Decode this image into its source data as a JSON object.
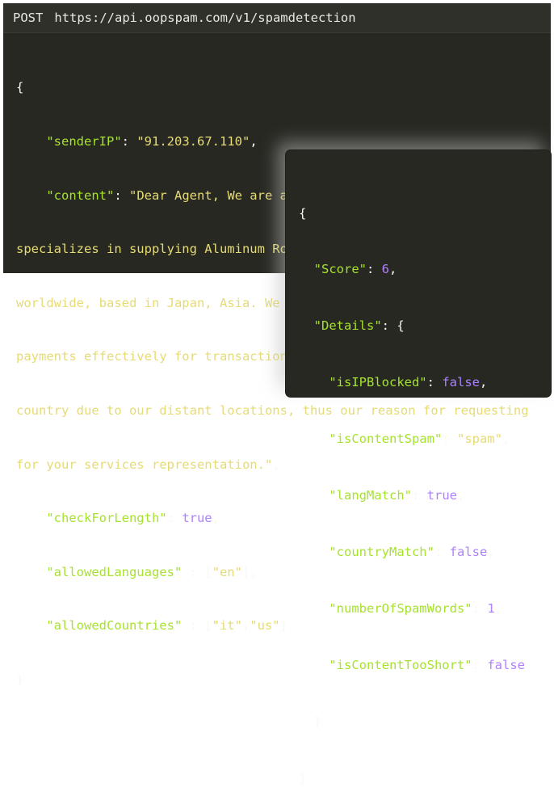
{
  "request": {
    "method": "POST",
    "url": "https://api.oopspam.com/v1/spamdetection",
    "open_brace": "{",
    "close_brace": "}",
    "fields": {
      "senderIP_key": "\"senderIP\"",
      "senderIP_value": "\"91.203.67.110\"",
      "content_key": "\"content\"",
      "content_value_line1": "\"Dear Agent, We are a manufacturing company which",
      "content_value_line2": "specializes in supplying Aluminum Rod with Zinc Alloy Rod to customers",
      "content_value_line3": "worldwide, based in Japan, Asia. We have been unable to follow up",
      "content_value_line4": "payments effectively for transactions with debtor customers in your",
      "content_value_line5": "country due to our distant locations, thus our reason for requesting",
      "content_value_line6": "for your services representation.\"",
      "checkForLength_key": "\"checkForLength\"",
      "checkForLength_value": "true",
      "allowedLanguages_key": "\"allowedLanguages\"",
      "allowedLanguages_value": "\"en\"",
      "allowedCountries_key": "\"allowedCountries\"",
      "allowedCountries_value_1": "\"it\"",
      "allowedCountries_value_2": "\"us\""
    }
  },
  "response": {
    "open_brace": "{",
    "close_brace": "}",
    "score_key": "\"Score\"",
    "score_value": "6",
    "details_key": "\"Details\"",
    "details_open": "{",
    "details_close": "}",
    "details": {
      "isIPBlocked_key": "\"isIPBlocked\"",
      "isIPBlocked_value": "false",
      "isContentSpam_key": "\"isContentSpam\"",
      "isContentSpam_value": "\"spam\"",
      "langMatch_key": "\"langMatch\"",
      "langMatch_value": "true",
      "countryMatch_key": "\"countryMatch\"",
      "countryMatch_value": "false",
      "numberOfSpamWords_key": "\"numberOfSpamWords\"",
      "numberOfSpamWords_value": "1",
      "isContentTooShort_key": "\"isContentTooShort\"",
      "isContentTooShort_value": "false"
    }
  },
  "colors": {
    "background": "#272822",
    "key": "#a6e22e",
    "string": "#e6db74",
    "literal": "#ae81ff",
    "punctuation": "#f8f8f2"
  }
}
